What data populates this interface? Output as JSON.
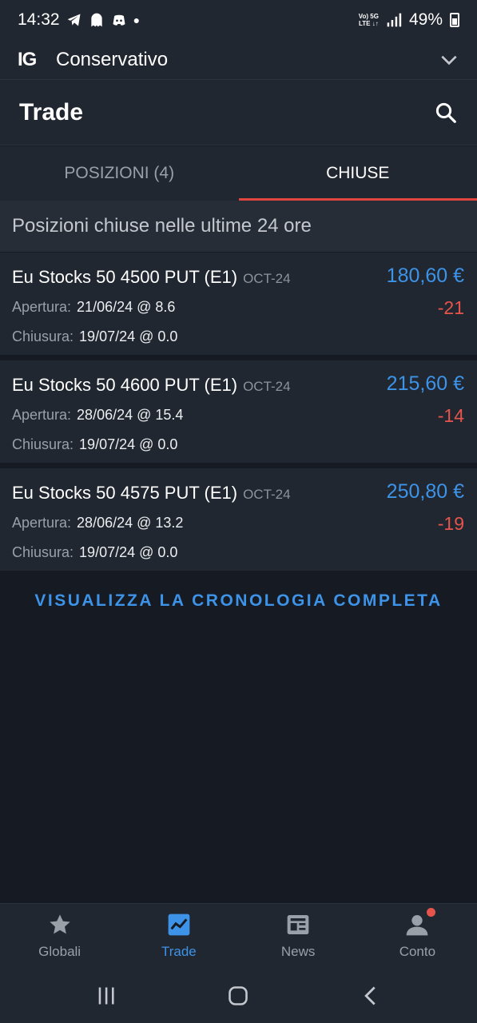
{
  "status_bar": {
    "time": "14:32",
    "net_top": "Vo) 5G",
    "net_bottom": "LTE ↓↑",
    "battery": "49%"
  },
  "account": {
    "logo": "IG",
    "name": "Conservativo"
  },
  "header": {
    "title": "Trade"
  },
  "tabs": [
    {
      "label": "POSIZIONI (4)",
      "active": false
    },
    {
      "label": "CHIUSE",
      "active": true
    }
  ],
  "section": {
    "title": "Posizioni chiuse nelle ultime 24 ore"
  },
  "positions": [
    {
      "name": "Eu Stocks 50 4500 PUT (E1)",
      "expiry": "OCT-24",
      "price": "180,60 €",
      "pl": "-21",
      "open_label": "Apertura:",
      "open_value": "21/06/24 @ 8.6",
      "close_label": "Chiusura:",
      "close_value": "19/07/24 @ 0.0"
    },
    {
      "name": "Eu Stocks 50 4600 PUT (E1)",
      "expiry": "OCT-24",
      "price": "215,60 €",
      "pl": "-14",
      "open_label": "Apertura:",
      "open_value": "28/06/24 @ 15.4",
      "close_label": "Chiusura:",
      "close_value": "19/07/24 @ 0.0"
    },
    {
      "name": "Eu Stocks 50 4575 PUT (E1)",
      "expiry": "OCT-24",
      "price": "250,80 €",
      "pl": "-19",
      "open_label": "Apertura:",
      "open_value": "28/06/24 @ 13.2",
      "close_label": "Chiusura:",
      "close_value": "19/07/24 @ 0.0"
    }
  ],
  "history_link": "VISUALIZZA LA CRONOLOGIA COMPLETA",
  "bottom_nav": [
    {
      "label": "Globali",
      "icon": "star-icon",
      "active": false
    },
    {
      "label": "Trade",
      "icon": "chart-icon",
      "active": true
    },
    {
      "label": "News",
      "icon": "newspaper-icon",
      "active": false
    },
    {
      "label": "Conto",
      "icon": "account-icon",
      "active": false
    }
  ],
  "colors": {
    "accent_blue": "#3d93e8",
    "negative_red": "#e6544c",
    "tab_indicator": "#e0453d",
    "background": "#161a22"
  }
}
